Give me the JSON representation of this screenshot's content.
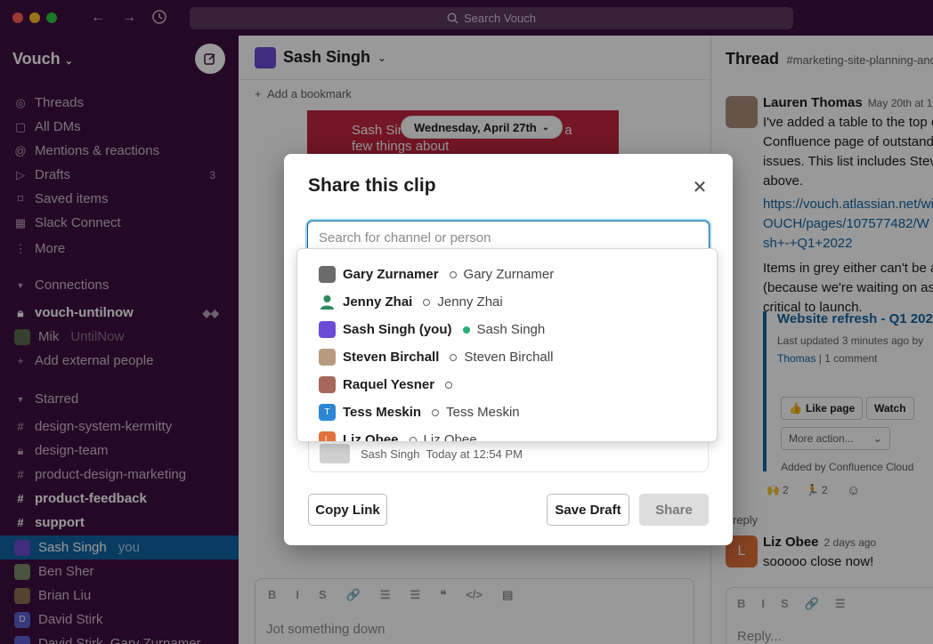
{
  "titlebar": {
    "search_placeholder": "Search Vouch"
  },
  "sidebar": {
    "workspace": "Vouch",
    "nav": [
      {
        "label": "Threads",
        "icon": "threads-icon"
      },
      {
        "label": "All DMs",
        "icon": "dm-icon"
      },
      {
        "label": "Mentions & reactions",
        "icon": "at-icon"
      },
      {
        "label": "Drafts",
        "icon": "drafts-icon",
        "count": "3"
      },
      {
        "label": "Saved items",
        "icon": "bookmark-icon"
      },
      {
        "label": "Slack Connect",
        "icon": "building-icon"
      },
      {
        "label": "More",
        "icon": "more-icon"
      }
    ],
    "connections_header": "Connections",
    "connections": [
      {
        "label": "vouch-untilnow"
      },
      {
        "label": "Mik",
        "sub": "UntilNow"
      },
      {
        "label": "Add external people"
      }
    ],
    "starred_header": "Starred",
    "starred": [
      {
        "label": "design-system-kermitty",
        "prefix": "#"
      },
      {
        "label": "design-team",
        "prefix": "🔒"
      },
      {
        "label": "product-design-marketing",
        "prefix": "#"
      },
      {
        "label": "product-feedback",
        "prefix": "#"
      },
      {
        "label": "support",
        "prefix": "#"
      }
    ],
    "dms": [
      {
        "label": "Sash Singh",
        "sub": "you"
      },
      {
        "label": "Ben Sher"
      },
      {
        "label": "Brian Liu"
      },
      {
        "label": "David Stirk"
      },
      {
        "label": "David Stirk, Gary Zurnamer"
      }
    ]
  },
  "main": {
    "channel_title": "Sash Singh",
    "bookmark": "Add a bookmark",
    "card_text": "Sash Singh                                  ya is inviting you to say a few things about",
    "date_pill": "Wednesday, April 27th",
    "composer_placeholder": "Jot something down",
    "composer_tools": [
      "B",
      "I",
      "S",
      "🔗",
      "☰",
      "☰",
      "❝",
      "</>",
      "▤"
    ]
  },
  "thread": {
    "title": "Thread",
    "channel": "#marketing-site-planning-and-",
    "msg1_name": "Lauren Thomas",
    "msg1_time": "May 20th at 1",
    "msg1_lines": [
      "I've added a table to the top o",
      "Confluence page of outstandin",
      "issues. This list includes Steve'",
      "above."
    ],
    "link_lines": [
      "https://vouch.atlassian.net/wi",
      "OUCH/pages/107577482/W",
      "sh+-+Q1+2022"
    ],
    "msg1_lines2": [
      "Items in grey either can't be ac",
      "(because we're waiting on asse",
      "critical to launch."
    ],
    "conf_title": "Website refresh - Q1 2022",
    "conf_meta1": "Last updated 3 minutes ago by",
    "conf_meta2_name": "Thomas",
    "conf_meta2_rest": " | 1 comment",
    "like_btn": "Like page",
    "watch_btn": "Watch",
    "more_btn": "More action...",
    "added_by": "Added by Confluence Cloud",
    "reactions": [
      {
        "emoji": "🙌",
        "count": "2"
      },
      {
        "emoji": "🏃",
        "count": "2"
      }
    ],
    "reply_count": "reply",
    "msg2_name": "Liz Obee",
    "msg2_time": "2 days ago",
    "msg2_text": "sooooo close now!",
    "reply_placeholder": "Reply..."
  },
  "modal": {
    "title": "Share this clip",
    "search_placeholder": "Search for channel or person",
    "results": [
      {
        "name": "Gary Zurnamer",
        "full": "Gary Zurnamer",
        "active": false,
        "avatar_color": "#6b6b6b",
        "initial": ""
      },
      {
        "name": "Jenny Zhai",
        "full": "Jenny Zhai",
        "active": false,
        "avatar_color": "#2d8a5b",
        "initial": ""
      },
      {
        "name": "Sash Singh (you)",
        "full": "Sash Singh",
        "active": true,
        "avatar_color": "#6c4bd6",
        "initial": ""
      },
      {
        "name": "Steven Birchall",
        "full": "Steven Birchall",
        "active": false,
        "avatar_color": "#b89a7e",
        "initial": ""
      },
      {
        "name": "Raquel Yesner",
        "full": "",
        "active": false,
        "avatar_color": "#a5685a",
        "initial": ""
      },
      {
        "name": "Tess Meskin",
        "full": "Tess Meskin",
        "active": false,
        "avatar_color": "#2b87d3",
        "initial": "T"
      },
      {
        "name": "Liz Obee",
        "full": "Liz Obee",
        "active": false,
        "avatar_color": "#e1723b",
        "initial": "L"
      }
    ],
    "clip_meta_name": "Sash Singh",
    "clip_meta_time": "Today at 12:54 PM",
    "copy_link": "Copy Link",
    "save_draft": "Save Draft",
    "share": "Share"
  }
}
